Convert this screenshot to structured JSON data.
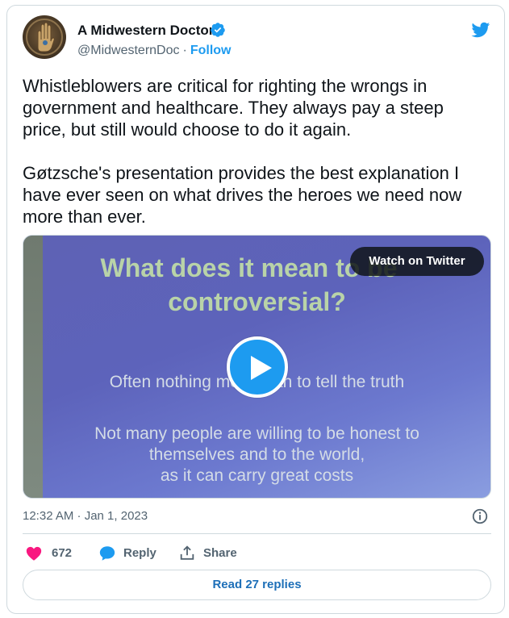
{
  "author": {
    "name": "A Midwestern Doctor",
    "handle": "@MidwesternDoc",
    "separator": "·",
    "follow_label": "Follow",
    "avatar_icon": "avatar-hand-icon",
    "verified_icon": "verified-badge-icon"
  },
  "brand": {
    "logo_icon": "twitter-bird-icon",
    "color": "#1d9bf0"
  },
  "tweet": {
    "paragraphs": [
      "Whistleblowers are critical for righting the wrongs in government and healthcare.  They always pay a steep price, but still would choose to do it again.",
      "Gøtzsche's presentation provides the best explanation I have ever seen on what drives the heroes we need now more than ever."
    ]
  },
  "media": {
    "watch_label": "Watch on Twitter",
    "play_icon": "play-icon",
    "slide": {
      "title_line1": "What does it mean to be",
      "title_line2": "controversial?",
      "line1": "Often nothing more than to tell the truth",
      "line2": "Not many people are willing to be honest to",
      "line3": "themselves and to the world,",
      "line4": "as it can carry great costs"
    }
  },
  "meta": {
    "timestamp": "12:32 AM · Jan 1, 2023",
    "info_icon": "info-icon"
  },
  "actions": {
    "like_count": "672",
    "like_icon": "heart-icon",
    "reply_label": "Reply",
    "reply_icon": "speech-bubble-icon",
    "share_label": "Share",
    "share_icon": "share-upload-icon",
    "like_color": "#f91880",
    "reply_color": "#1d9bf0"
  },
  "footer": {
    "read_replies_label": "Read 27 replies"
  }
}
